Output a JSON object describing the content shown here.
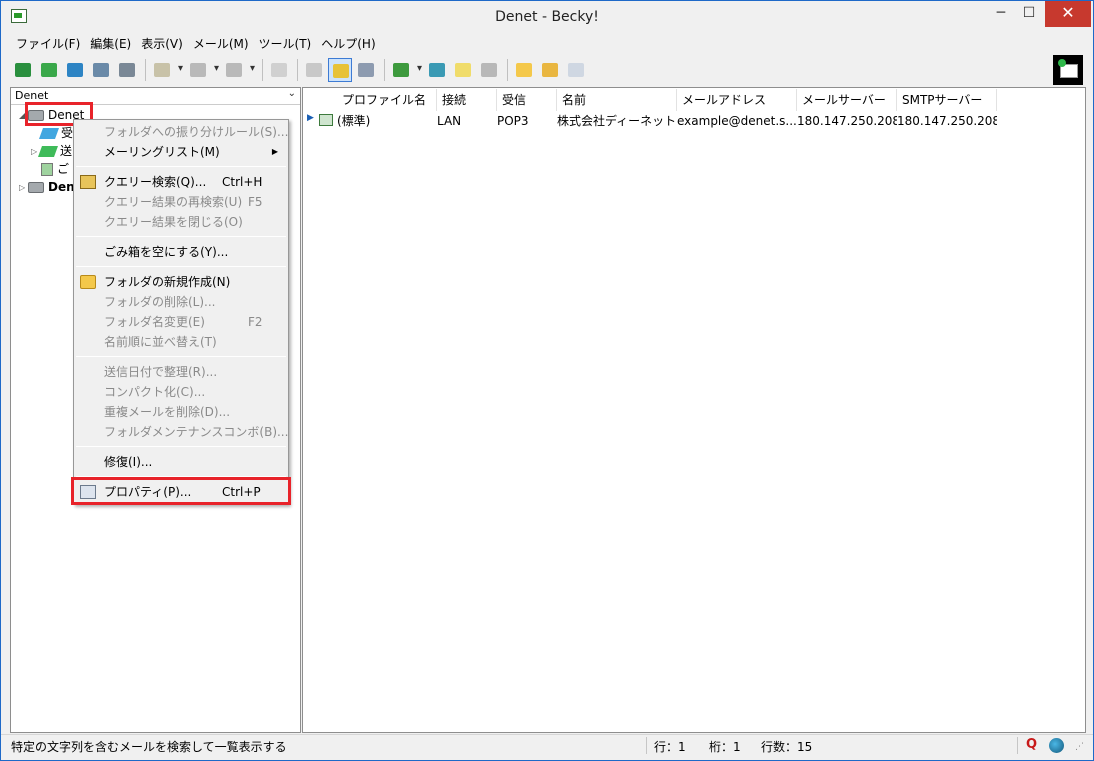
{
  "window": {
    "title": "Denet - Becky!",
    "minimize": "─",
    "maximize": "☐",
    "close": "✕"
  },
  "menu": [
    "ファイル(F)",
    "編集(E)",
    "表示(V)",
    "メール(M)",
    "ツール(T)",
    "ヘルプ(H)"
  ],
  "folder_selector": "Denet",
  "tree": {
    "root": "Denet",
    "inbox": "受",
    "sent": "送",
    "trash": "ご",
    "second": "Dene"
  },
  "columns": [
    "プロファイル名",
    "接続",
    "受信",
    "名前",
    "メールアドレス",
    "メールサーバー",
    "SMTPサーバー"
  ],
  "row": {
    "profile": "(標準)",
    "connection": "LAN",
    "receive": "POP3",
    "name": "株式会社ディーネット",
    "email": "example@denet.s...",
    "mail_server": "180.147.250.208",
    "smtp_server": "180.147.250.208"
  },
  "context_menu": [
    {
      "label": "フォルダへの振り分けルール(S)...",
      "shortcut": "",
      "disabled": true
    },
    {
      "label": "メーリングリスト(M)",
      "shortcut": "",
      "disabled": false,
      "submenu": "▶"
    },
    {
      "label": "クエリー検索(Q)...",
      "shortcut": "Ctrl+H",
      "disabled": false
    },
    {
      "label": "クエリー結果の再検索(U)",
      "shortcut": "F5",
      "disabled": true
    },
    {
      "label": "クエリー結果を閉じる(O)",
      "shortcut": "",
      "disabled": true
    },
    {
      "label": "ごみ箱を空にする(Y)...",
      "shortcut": "",
      "disabled": false
    },
    {
      "label": "フォルダの新規作成(N)",
      "shortcut": "",
      "disabled": false
    },
    {
      "label": "フォルダの削除(L)...",
      "shortcut": "",
      "disabled": true
    },
    {
      "label": "フォルダ名変更(E)",
      "shortcut": "F2",
      "disabled": true
    },
    {
      "label": "名前順に並べ替え(T)",
      "shortcut": "",
      "disabled": true
    },
    {
      "label": "送信日付で整理(R)...",
      "shortcut": "",
      "disabled": true
    },
    {
      "label": "コンパクト化(C)...",
      "shortcut": "",
      "disabled": true
    },
    {
      "label": "重複メールを削除(D)...",
      "shortcut": "",
      "disabled": true
    },
    {
      "label": "フォルダメンテナンスコンボ(B)...",
      "shortcut": "",
      "disabled": true
    },
    {
      "label": "修復(I)...",
      "shortcut": "",
      "disabled": false
    },
    {
      "label": "プロパティ(P)...",
      "shortcut": "Ctrl+P",
      "disabled": false
    }
  ],
  "status": {
    "message": "特定の文字列を含むメールを検索して一覧表示する",
    "row": "行：1",
    "col": "桁：1",
    "lines": "行数：15",
    "q": "Q"
  },
  "colors": {
    "highlight": "#e8232a",
    "selected_tool": "#cde3fb"
  },
  "icons": [
    "receive-mail-icon",
    "send-mail-icon",
    "new-mail-icon",
    "sync-icon",
    "address-book-icon",
    "reply-icon",
    "forward-icon",
    "delete-icon",
    "edit-icon",
    "properties-icon",
    "folder-icon",
    "becky-logo-icon",
    "globe-icon"
  ]
}
